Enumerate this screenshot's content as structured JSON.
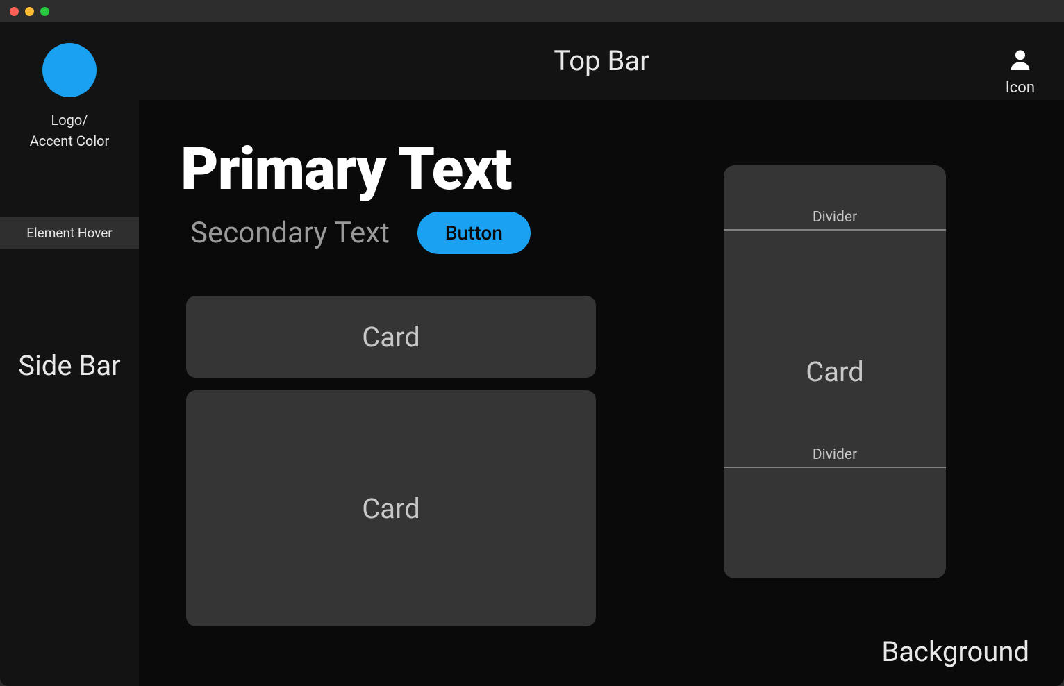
{
  "titlebar": {
    "traffic_lights": [
      "close",
      "minimize",
      "maximize"
    ]
  },
  "sidebar": {
    "logo_label_line1": "Logo/",
    "logo_label_line2": "Accent Color",
    "hover_item": "Element Hover",
    "title": "Side Bar"
  },
  "topbar": {
    "title": "Top Bar",
    "icon_label": "Icon",
    "icon_name": "user-icon"
  },
  "main": {
    "primary_text": "Primary Text",
    "secondary_text": "Secondary Text",
    "button_label": "Button",
    "cards_left": [
      {
        "label": "Card"
      },
      {
        "label": "Card"
      }
    ],
    "card_right": {
      "label": "Card",
      "divider_top": "Divider",
      "divider_bottom": "Divider"
    },
    "background_label": "Background"
  },
  "colors": {
    "accent": "#1ba1f2",
    "background": "#0a0a0a",
    "sidebar": "#131313",
    "card": "#353535",
    "primary_text": "#ffffff",
    "secondary_text": "#9a9a9a"
  }
}
